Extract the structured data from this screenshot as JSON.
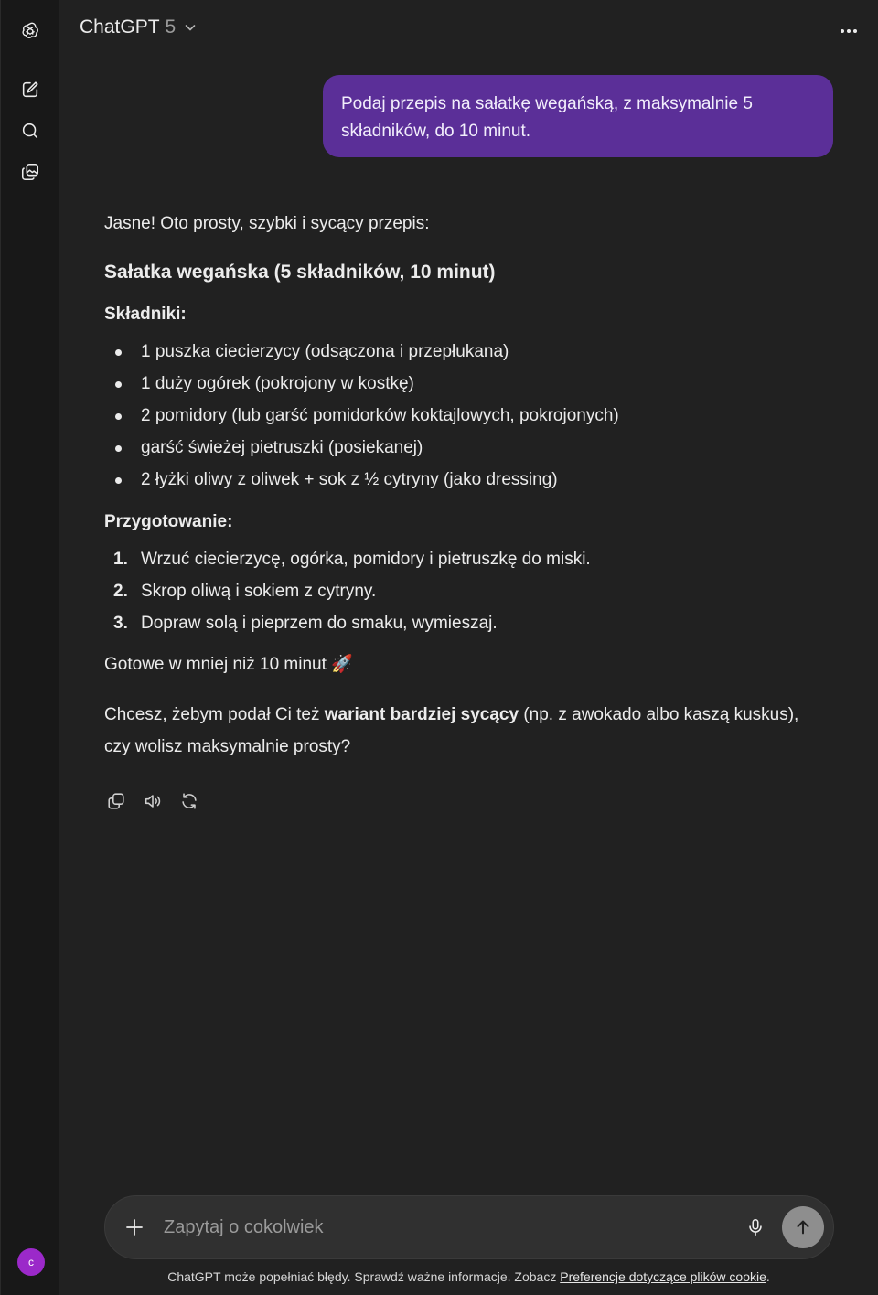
{
  "header": {
    "model_name": "ChatGPT",
    "model_version": "5"
  },
  "sidebar": {
    "items": [
      {
        "name": "new-chat",
        "icon": "edit-icon"
      },
      {
        "name": "search-chats",
        "icon": "search-icon"
      },
      {
        "name": "library",
        "icon": "images-icon"
      }
    ],
    "avatar_letter": "c",
    "avatar_color": "#9b29c9"
  },
  "messages": {
    "user": "Podaj przepis na sałatkę wegańską, z maksymalnie 5 składników, do 10 minut.",
    "assistant": {
      "intro": "Jasne! Oto prosty, szybki i sycący przepis:",
      "title": "Sałatka wegańska (5 składników, 10 minut)",
      "ingredients_heading": "Składniki:",
      "ingredients": [
        "1 puszka ciecierzycy (odsączona i przepłukana)",
        "1 duży ogórek (pokrojony w kostkę)",
        "2 pomidory (lub garść pomidorków koktajlowych, pokrojonych)",
        "garść świeżej pietruszki (posiekanej)",
        "2 łyżki oliwy z oliwek + sok z ½ cytryny (jako dressing)"
      ],
      "steps_heading": "Przygotowanie:",
      "steps": [
        {
          "num": "1.",
          "text": "Wrzuć ciecierzycę, ogórka, pomidory i pietruszkę do miski."
        },
        {
          "num": "2.",
          "text": "Skrop oliwą i sokiem z cytryny."
        },
        {
          "num": "3.",
          "text": "Dopraw solą i pieprzem do smaku, wymieszaj."
        }
      ],
      "done": "Gotowe w mniej niż 10 minut 🚀",
      "question_pre": "Chcesz, żebym podał Ci też ",
      "question_bold": "wariant bardziej sycący",
      "question_post": " (np. z awokado albo kaszą kuskus), czy wolisz maksymalnie prosty?"
    }
  },
  "message_actions": [
    "copy-icon",
    "read-aloud-icon",
    "regenerate-icon"
  ],
  "composer": {
    "placeholder": "Zapytaj o cokolwiek"
  },
  "footer": {
    "text": "ChatGPT może popełniać błędy. Sprawdź ważne informacje. Zobacz ",
    "link": "Preferencje dotyczące plików cookie",
    "end": "."
  },
  "colors": {
    "background": "#212121",
    "sidebar": "#181818",
    "user_bubble": "#5b2f98",
    "send_button": "#8e8e8e"
  }
}
